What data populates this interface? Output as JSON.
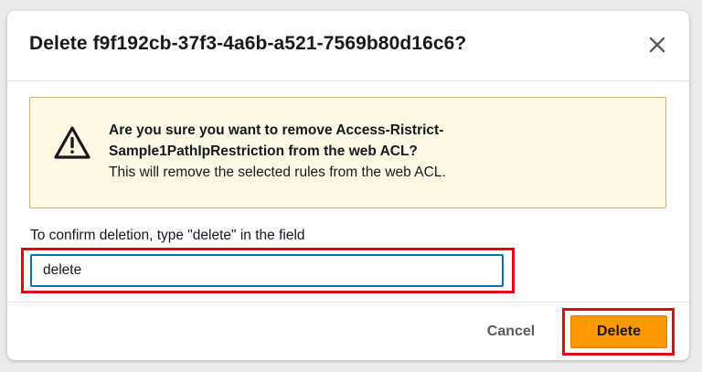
{
  "dialog": {
    "title": "Delete f9f192cb-37f3-4a6b-a521-7569b80d16c6?",
    "close_icon": "close-icon"
  },
  "alert": {
    "icon": "warning-icon",
    "title_line1": "Are you sure you want to remove Access-Ristrict-",
    "title_line2": "Sample1PathIpRestriction from the web ACL?",
    "body": "This will remove the selected rules from the web ACL.",
    "background_color": "#fdf9e5",
    "border_color": "#c9b36a"
  },
  "confirm": {
    "label": "To confirm deletion, type \"delete\" in the field",
    "value": "delete"
  },
  "footer": {
    "cancel_label": "Cancel",
    "delete_label": "Delete"
  },
  "colors": {
    "primary_button": "#ff9900",
    "highlight": "#e30613",
    "input_focus": "#0073bb"
  }
}
